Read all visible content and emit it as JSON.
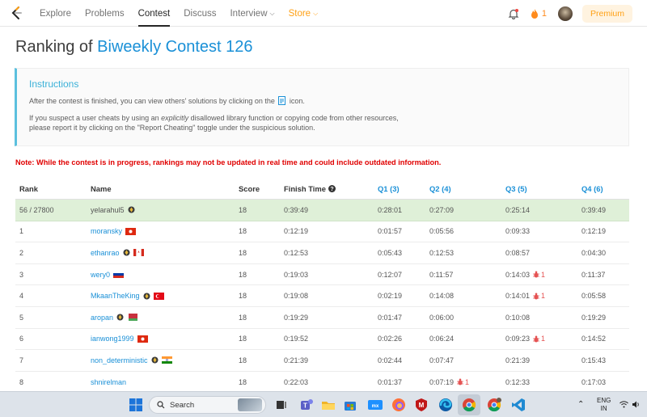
{
  "nav": {
    "links": [
      "Explore",
      "Problems",
      "Contest",
      "Discuss",
      "Interview",
      "Store"
    ],
    "streak": "1",
    "premium": "Premium"
  },
  "title": {
    "prefix": "Ranking of ",
    "contest": "Biweekly Contest 126"
  },
  "instructions": {
    "title": "Instructions",
    "line1_a": "After the contest is finished, you can view others' solutions by clicking on the",
    "line1_b": "icon.",
    "line2_a": "If you suspect a user cheats by using an ",
    "line2_em": "explicitly",
    "line2_b": " disallowed library function or copying code from other resources,",
    "line3": "please report it by clicking on the \"Report Cheating\" toggle under the suspicious solution."
  },
  "note": "Note: While the contest is in progress, rankings may not be updated in real time and could include outdated information.",
  "table": {
    "headers": {
      "rank": "Rank",
      "name": "Name",
      "score": "Score",
      "finish": "Finish Time",
      "q1": "Q1 (3)",
      "q2": "Q2 (4)",
      "q3": "Q3 (5)",
      "q4": "Q4 (6)"
    },
    "rows": [
      {
        "rank": "56 / 27800",
        "name": "yelarahul5",
        "score": "18",
        "finish": "0:39:49",
        "q1": "0:28:01",
        "q2": "0:27:09",
        "q3": "0:25:14",
        "q4": "0:39:49",
        "badge": true
      },
      {
        "rank": "1",
        "name": "moransky",
        "score": "18",
        "finish": "0:12:19",
        "q1": "0:01:57",
        "q2": "0:05:56",
        "q3": "0:09:33",
        "q4": "0:12:19",
        "flag": "hk"
      },
      {
        "rank": "2",
        "name": "ethanrao",
        "score": "18",
        "finish": "0:12:53",
        "q1": "0:05:43",
        "q2": "0:12:53",
        "q3": "0:08:57",
        "q4": "0:04:30",
        "badge": true,
        "flag": "ca"
      },
      {
        "rank": "3",
        "name": "wery0",
        "score": "18",
        "finish": "0:19:03",
        "q1": "0:12:07",
        "q2": "0:11:57",
        "q3": "0:14:03",
        "q3_bug": "1",
        "q4": "0:11:37",
        "flag": "ru"
      },
      {
        "rank": "4",
        "name": "MkaanTheKing",
        "score": "18",
        "finish": "0:19:08",
        "q1": "0:02:19",
        "q2": "0:14:08",
        "q3": "0:14:01",
        "q3_bug": "1",
        "q4": "0:05:58",
        "badge": true,
        "flag": "tr"
      },
      {
        "rank": "5",
        "name": "aropan",
        "score": "18",
        "finish": "0:19:29",
        "q1": "0:01:47",
        "q2": "0:06:00",
        "q3": "0:10:08",
        "q4": "0:19:29",
        "badge": true,
        "flag": "by"
      },
      {
        "rank": "6",
        "name": "ianwong1999",
        "score": "18",
        "finish": "0:19:52",
        "q1": "0:02:26",
        "q2": "0:06:24",
        "q3": "0:09:23",
        "q3_bug": "1",
        "q4": "0:14:52",
        "flag": "hk"
      },
      {
        "rank": "7",
        "name": "non_deterministic",
        "score": "18",
        "finish": "0:21:39",
        "q1": "0:02:44",
        "q2": "0:07:47",
        "q3": "0:21:39",
        "q4": "0:15:43",
        "badge": true,
        "flag": "in"
      },
      {
        "rank": "8",
        "name": "shnirelman",
        "score": "18",
        "finish": "0:22:03",
        "q1": "0:01:37",
        "q2": "0:07:19",
        "q2_bug": "1",
        "q3": "0:12:33",
        "q4": "0:17:03"
      }
    ]
  },
  "taskbar": {
    "search": "Search",
    "lang_top": "ENG",
    "lang_bottom": "IN"
  },
  "colors": {
    "accent": "#1a90d7",
    "store": "#ffa116",
    "note": "#e00000",
    "my_row": "#dff0d8"
  }
}
